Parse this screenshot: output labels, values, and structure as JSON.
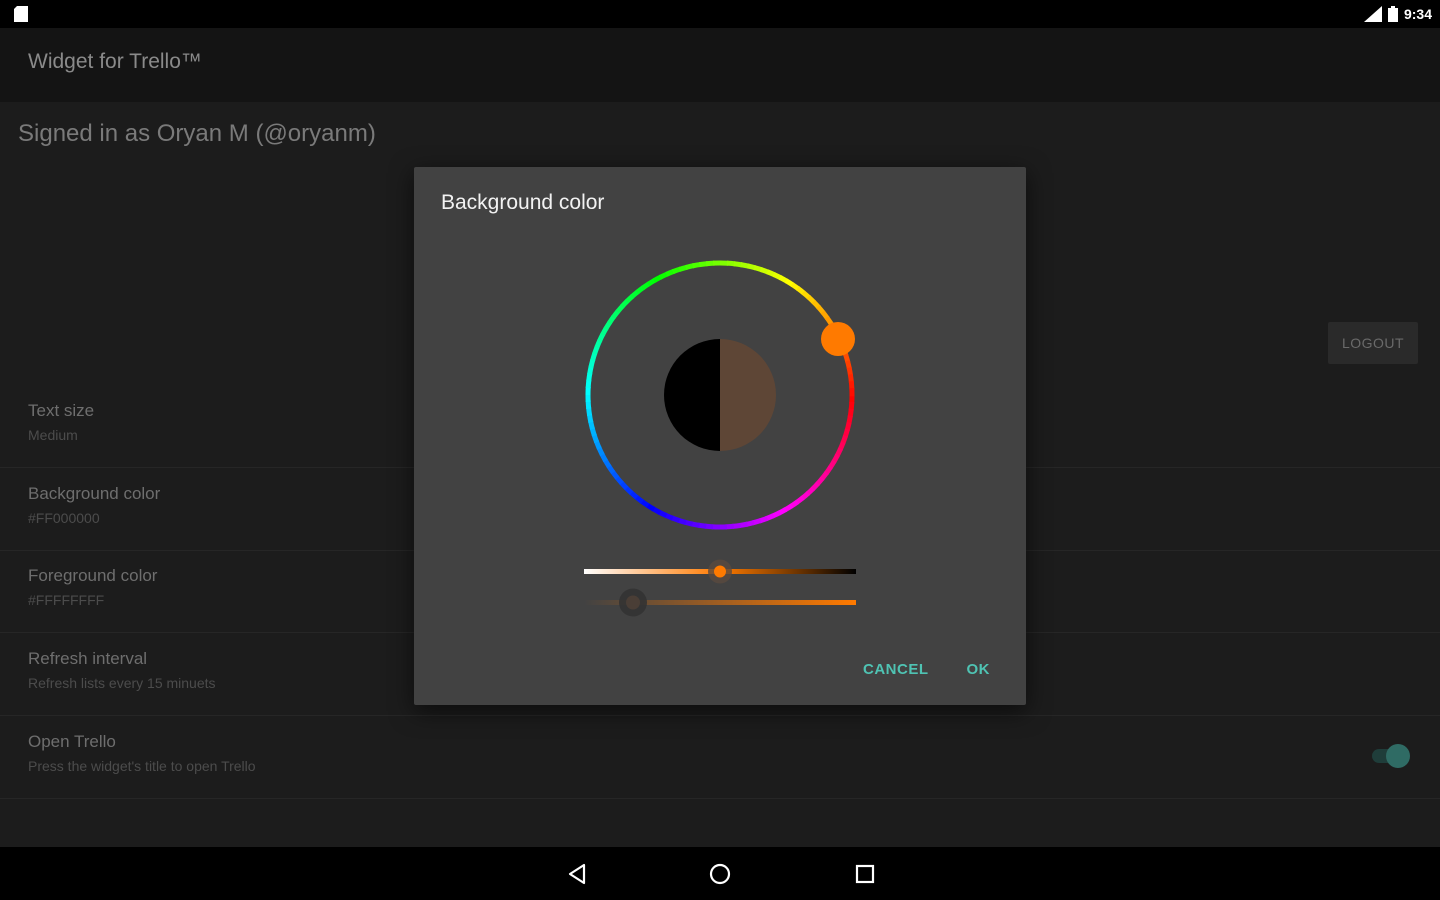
{
  "status_bar": {
    "time": "9:34",
    "icons": [
      "sd-card-icon",
      "signal-icon",
      "battery-icon"
    ]
  },
  "app_bar": {
    "title": "Widget for Trello™"
  },
  "account": {
    "signed_in_text": "Signed in as Oryan M (@oryanm)",
    "logout_label": "LOGOUT"
  },
  "preferences": [
    {
      "title": "Text size",
      "summary": "Medium"
    },
    {
      "title": "Background color",
      "summary": "#FF000000"
    },
    {
      "title": "Foreground color",
      "summary": "#FFFFFFFF"
    },
    {
      "title": "Refresh interval",
      "summary": "Refresh lists every 15 minuets"
    },
    {
      "title": "Open Trello",
      "summary": "Press the widget's title to open Trello",
      "toggle": true
    }
  ],
  "dialog": {
    "title": "Background color",
    "cancel_label": "CANCEL",
    "ok_label": "OK",
    "old_color": "#000000",
    "new_color": "#5e4636",
    "hue_color": "#ff7a00",
    "saturation_value": 0.5,
    "opacity_value": 0.18
  },
  "nav_bar": {
    "icons": [
      "back-icon",
      "home-icon",
      "recents-icon"
    ]
  },
  "colors": {
    "accent": "#4fc3b3",
    "dialog_bg": "#424242",
    "screen_bg": "#1c1c1c"
  }
}
